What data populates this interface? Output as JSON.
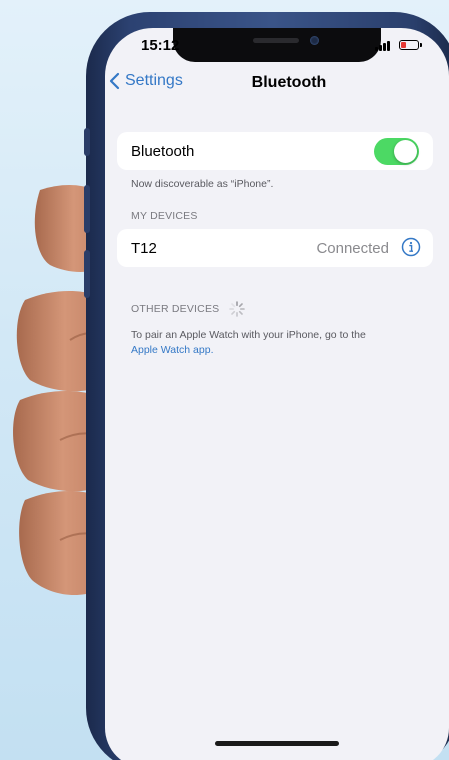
{
  "status_bar": {
    "time": "15:12"
  },
  "nav": {
    "back_label": "Settings",
    "title": "Bluetooth"
  },
  "bluetooth_row": {
    "label": "Bluetooth",
    "enabled": true
  },
  "discoverable_text": "Now discoverable as “iPhone”.",
  "my_devices": {
    "header": "MY DEVICES",
    "devices": [
      {
        "name": "T12",
        "status": "Connected"
      }
    ]
  },
  "other_devices": {
    "header": "OTHER DEVICES",
    "footnote_prefix": "To pair an Apple Watch with your iPhone, go to the",
    "footnote_link": "Apple Watch app."
  },
  "colors": {
    "accent": "#3478c6",
    "toggle_on": "#4cd964",
    "screen_bg": "#f2f2f7"
  },
  "icons": {
    "back": "chevron-left-icon",
    "info": "info-circle-icon",
    "spinner": "spinner-icon",
    "battery": "battery-charging-icon",
    "signal": "cellular-signal-icon"
  }
}
